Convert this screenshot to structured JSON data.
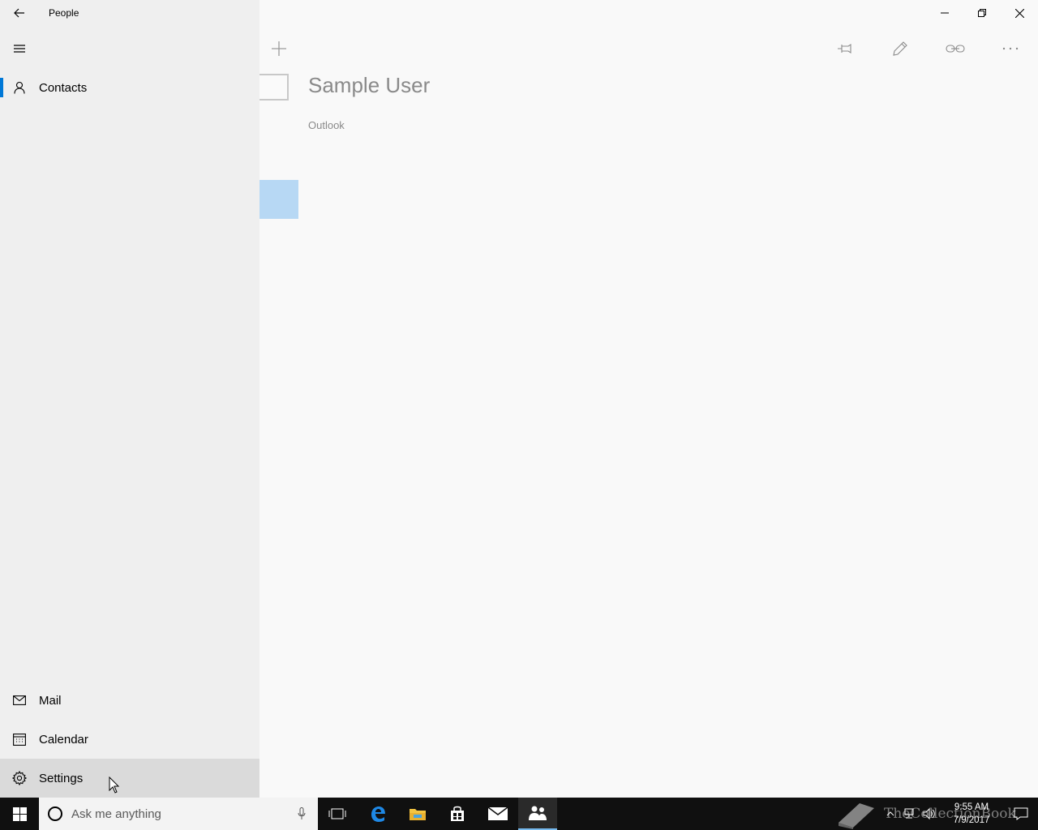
{
  "window": {
    "app_title": "People",
    "controls": [
      "minimize",
      "restore",
      "close"
    ]
  },
  "nav": {
    "top_items": [
      {
        "label": "Contacts",
        "icon": "person-icon",
        "selected": true
      }
    ],
    "bottom_items": [
      {
        "label": "Mail",
        "icon": "mail-icon"
      },
      {
        "label": "Calendar",
        "icon": "calendar-icon"
      },
      {
        "label": "Settings",
        "icon": "gear-icon",
        "hovered": true
      }
    ]
  },
  "contact": {
    "name": "Sample User",
    "source": "Outlook"
  },
  "command_bar": [
    "pin-icon",
    "edit-icon",
    "link-icon",
    "more-icon"
  ],
  "taskbar": {
    "search_placeholder": "Ask me anything",
    "apps": [
      "task-view-icon",
      "edge-icon",
      "file-explorer-icon",
      "store-icon",
      "mail-icon",
      "people-icon"
    ],
    "active_app": "people-icon",
    "watermark": "TheCollectionBook",
    "clock_time": "9:55 AM",
    "clock_date": "7/9/2017"
  },
  "colors": {
    "accent": "#0078d7",
    "nav_bg": "#efefef",
    "content_bg": "#f9f9f9",
    "highlight": "#b7d8f4",
    "taskbar_bg": "#101010"
  }
}
